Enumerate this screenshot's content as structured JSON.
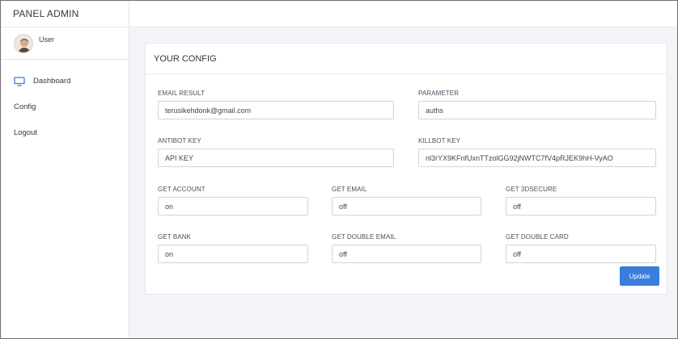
{
  "sidebar": {
    "brand": "PANEL ADMIN",
    "user_name": "User",
    "nav": [
      {
        "label": "Dashboard",
        "icon": "monitor-icon"
      },
      {
        "label": "Config"
      },
      {
        "label": "Logout"
      }
    ]
  },
  "colors": {
    "accent": "#3b7ddd",
    "main_bg": "#f2f4f7",
    "sidebar_bg": "#ffffff"
  },
  "config": {
    "title": "YOUR CONFIG",
    "fields": {
      "email_result": {
        "label": "EMAIL RESULT",
        "value": "terusikehdonk@gmail.com"
      },
      "parameter": {
        "label": "PARAMETER",
        "value": "auths"
      },
      "antibot_key": {
        "label": "ANTIBOT KEY",
        "value": "API KEY"
      },
      "killbot_key": {
        "label": "KILLBOT KEY",
        "value": "nl3rYX9KFnfUxnTTzolGG92jNWTC7fV4pRJEK9hH-VyAO"
      },
      "get_account": {
        "label": "GET ACCOUNT",
        "value": "on"
      },
      "get_email": {
        "label": "GET EMAIL",
        "value": "off"
      },
      "get_3dsecure": {
        "label": "GET 3DSECURE",
        "value": "off"
      },
      "get_bank": {
        "label": "GET BANK",
        "value": "on"
      },
      "get_double_email": {
        "label": "GET DOUBLE EMAIL",
        "value": "off"
      },
      "get_double_card": {
        "label": "GET DOUBLE CARD",
        "value": "off"
      }
    },
    "update_label": "Update"
  }
}
